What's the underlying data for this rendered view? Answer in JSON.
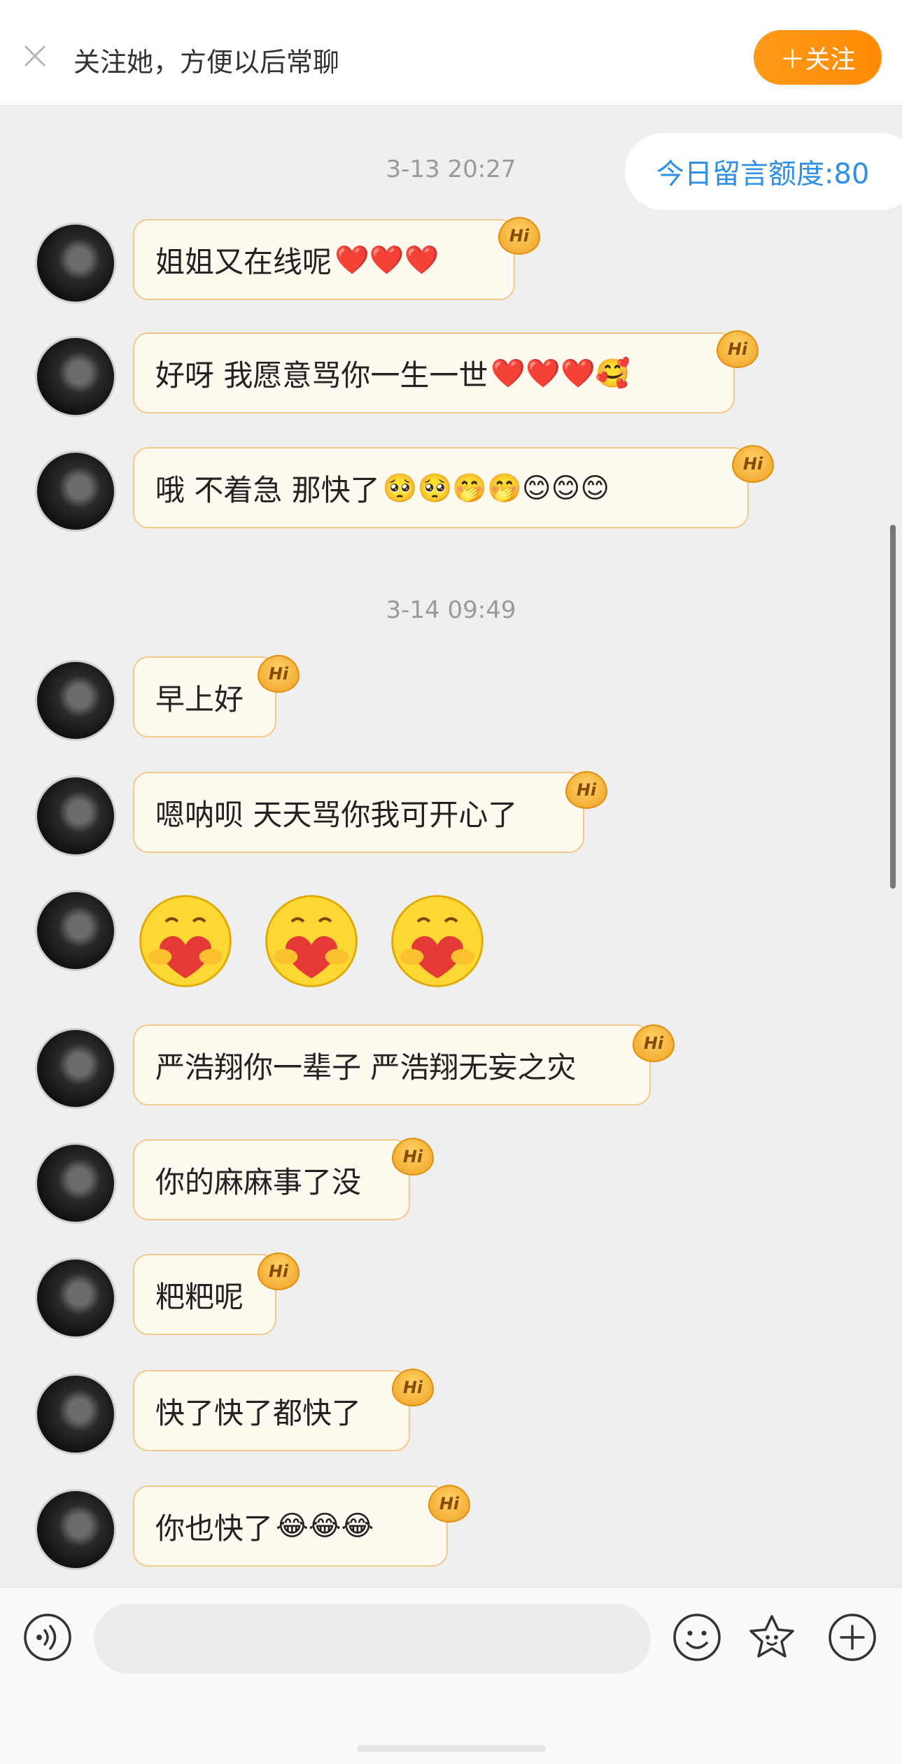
{
  "banner": {
    "text": "关注她，方便以后常聊",
    "follow_label": "＋关注"
  },
  "quota_label": "今日留言额度:80",
  "hi_label": "Hi",
  "sections": [
    {
      "timestamp": "3-13 20:27"
    },
    {
      "timestamp": "3-14 09:49"
    }
  ],
  "messages": [
    {
      "text": "姐姐又在线呢",
      "emoji": "❤️❤️❤️"
    },
    {
      "text": "好呀 我愿意骂你一生一世",
      "emoji": "❤️❤️❤️🥰"
    },
    {
      "text": "哦 不着急 那快了",
      "emoji": "🥺🥺🤭🤭😊😊😊"
    },
    {
      "text": "早上好",
      "emoji": ""
    },
    {
      "text": "嗯呐呗 天天骂你我可开心了",
      "emoji": ""
    },
    {
      "text": "",
      "emoji": "🥰🥰🥰"
    },
    {
      "text": "严浩翔你一辈子 严浩翔无妄之灾",
      "emoji": ""
    },
    {
      "text": "你的麻麻事了没",
      "emoji": ""
    },
    {
      "text": "粑粑呢",
      "emoji": ""
    },
    {
      "text": "快了快了都快了",
      "emoji": ""
    },
    {
      "text": "你也快了",
      "emoji": "😂😂😂"
    }
  ],
  "input": {
    "placeholder": ""
  },
  "icons": {
    "close": "close-icon",
    "voice": "voice-icon",
    "emoji": "smiley-icon",
    "sticker": "star-face-icon",
    "add": "plus-icon"
  },
  "colors": {
    "accent": "#ff9500",
    "quota_text": "#2f8fe4",
    "bubble_bg": "#fffaf0",
    "bubble_border": "#f2c98a"
  }
}
